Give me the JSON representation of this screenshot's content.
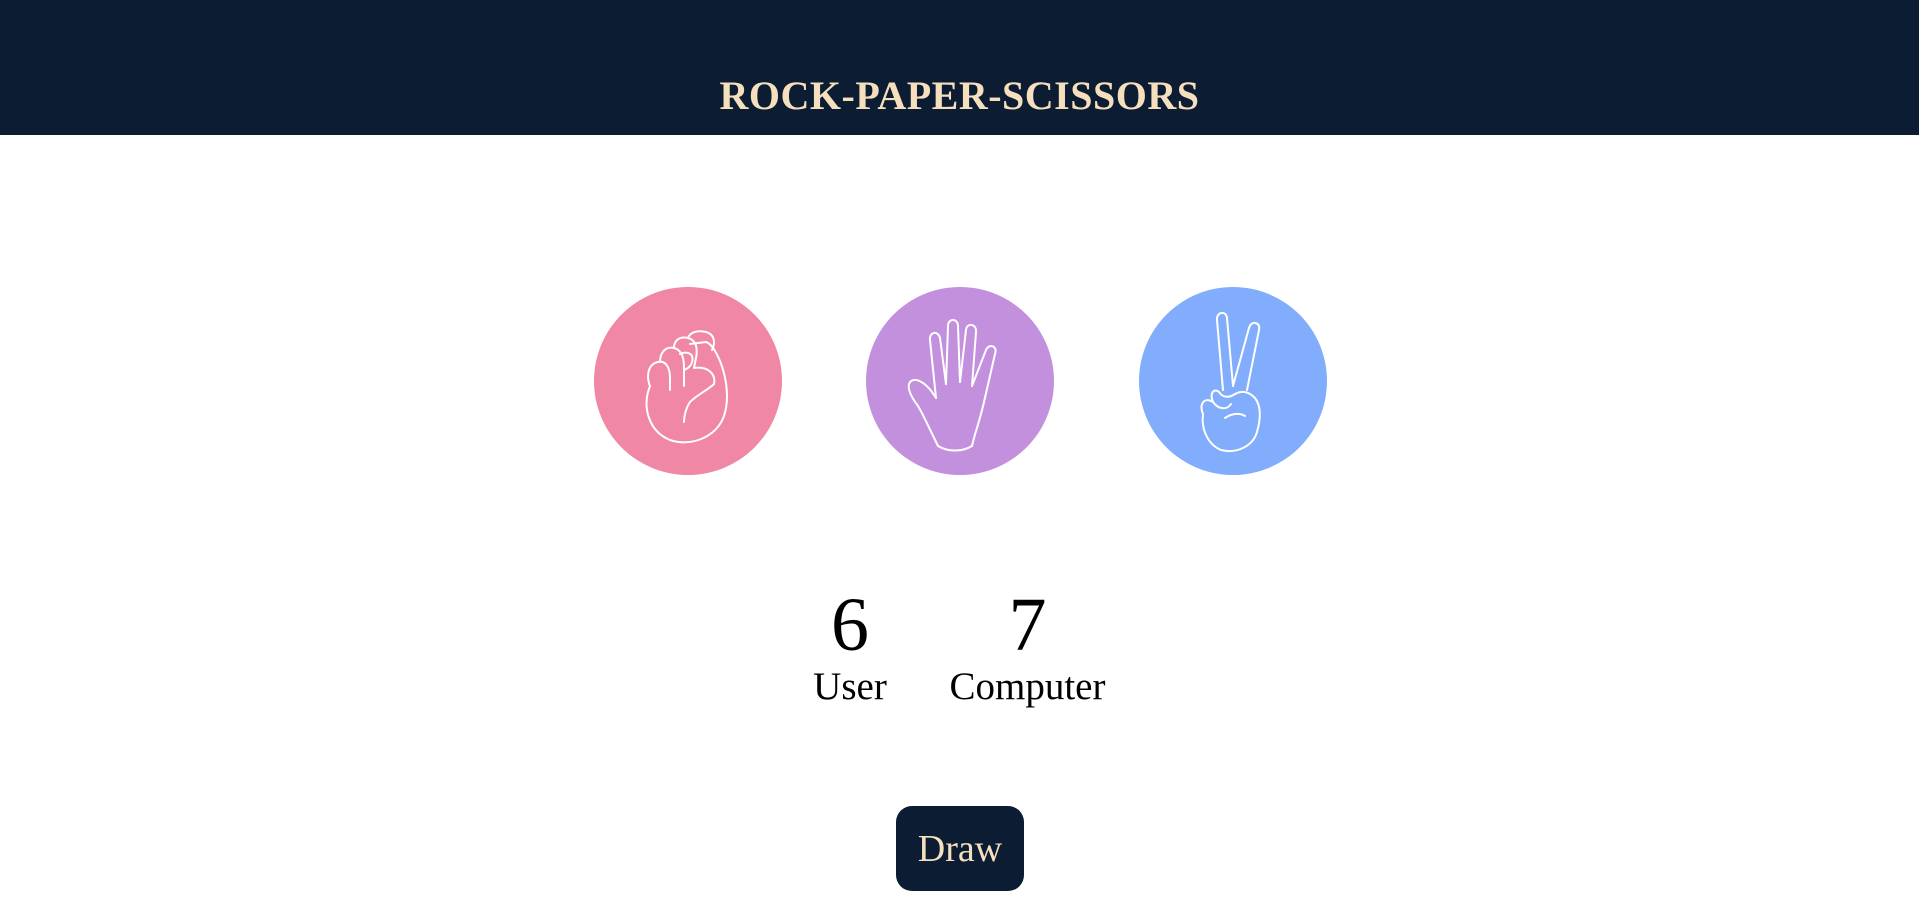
{
  "header": {
    "title": "ROCK-PAPER-SCISSORS"
  },
  "choices": [
    {
      "name": "rock",
      "icon": "rock-fist-icon",
      "color": "#f087a4"
    },
    {
      "name": "paper",
      "icon": "paper-hand-icon",
      "color": "#c390de"
    },
    {
      "name": "scissors",
      "icon": "scissors-hand-icon",
      "color": "#82adfc"
    }
  ],
  "scores": {
    "user": {
      "value": "6",
      "label": "User"
    },
    "computer": {
      "value": "7",
      "label": "Computer"
    }
  },
  "draw_button": {
    "label": "Draw"
  },
  "colors": {
    "header_bg": "#0b1c33",
    "title": "#f6dfbd",
    "button_bg": "#0b1c33",
    "button_text": "#f6dfbd"
  }
}
